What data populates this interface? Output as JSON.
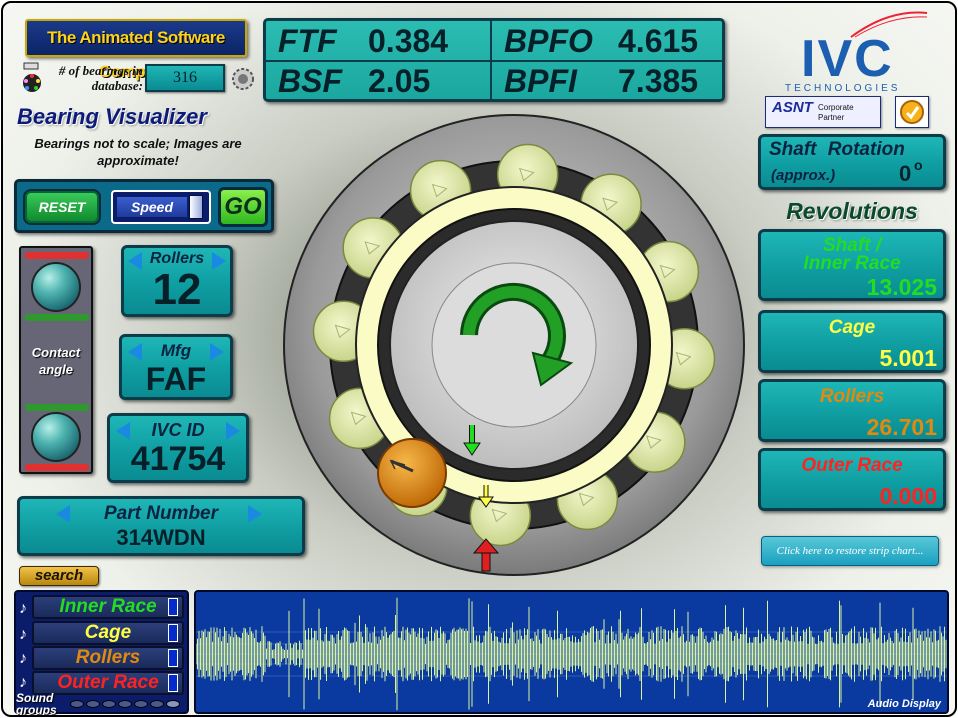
{
  "header": {
    "company_logo_text": "The Animated Software Company",
    "bearings_db_label": "# of bearings in database:",
    "bearings_db_count": "316"
  },
  "frequencies": {
    "ftf_label": "FTF",
    "ftf_value": "0.384",
    "bpfo_label": "BPFO",
    "bpfo_value": "4.615",
    "bsf_label": "BSF",
    "bsf_value": "2.05",
    "bpfi_label": "BPFI",
    "bpfi_value": "7.385"
  },
  "brand": {
    "ivc_text": "IVC",
    "ivc_sub": "TECHNOLOGIES",
    "partner_text": "Corporate Partner",
    "partner_logo": "ASNT"
  },
  "title": "Bearing Visualizer",
  "note": "Bearings not to scale; Images are approximate!",
  "controls": {
    "reset_label": "RESET",
    "speed_label": "Speed",
    "go_label": "GO"
  },
  "contact_angle_label": "Contact angle",
  "specs": {
    "rollers_label": "Rollers",
    "rollers_value": "12",
    "mfg_label": "Mfg",
    "mfg_value": "FAF",
    "ivc_id_label": "IVC ID",
    "ivc_id_value": "41754",
    "part_number_label": "Part Number",
    "part_number_value": "314WDN"
  },
  "search_label": "search",
  "shaft_rotation": {
    "label": "Shaft Rotation",
    "sub": "(approx.)",
    "value": "0",
    "unit": "o"
  },
  "revolutions": {
    "title": "Revolutions",
    "shaft_label_1": "Shaft /",
    "shaft_label_2": "Inner Race",
    "shaft_value": "13.025",
    "cage_label": "Cage",
    "cage_value": "5.001",
    "rollers_label": "Rollers",
    "rollers_value": "26.701",
    "outer_label": "Outer Race",
    "outer_value": "0.000"
  },
  "restore_label": "Click here to restore strip chart...",
  "sound_groups": {
    "label_1": "Sound",
    "label_2": "groups",
    "items": [
      "Inner Race",
      "Cage",
      "Rollers",
      "Outer Race"
    ],
    "note": "♪"
  },
  "audio_display_label": "Audio Display",
  "colors": {
    "inner_race": "#22dd22",
    "cage": "#ffff44",
    "rollers": "#e08a10",
    "outer_race": "#ff2222",
    "roller_fill": "#e8eeb8",
    "waveform": "#d8f4a0"
  }
}
